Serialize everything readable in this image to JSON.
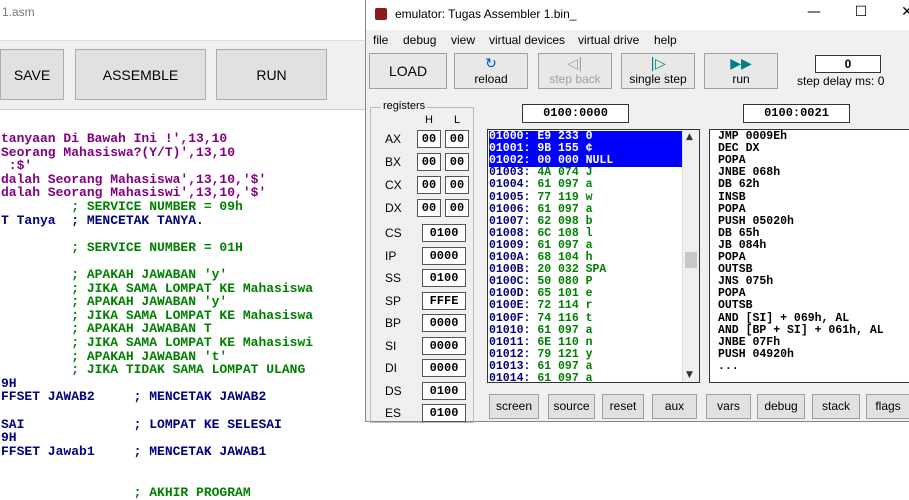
{
  "editor": {
    "title": "1.asm",
    "buttons": [
      "SAVE",
      "ASSEMBLE",
      "RUN"
    ],
    "code_lines": [
      {
        "text": "tanyaan Di Bawah Ini !',13,10",
        "color": "pur"
      },
      {
        "text": "Seorang Mahasiswa?(Y/T)',13,10",
        "color": "pur"
      },
      {
        "text": " :$'",
        "color": "pur"
      },
      {
        "text": "dalah Seorang Mahasiswa',13,10,'$'",
        "color": "pur"
      },
      {
        "text": "dalah Seorang Mahasiswi',13,10,'$'",
        "color": "pur"
      },
      {
        "text": "         ; SERVICE NUMBER = 09h",
        "color": "grn"
      },
      {
        "text": "T Tanya  ; MENCETAK TANYA.",
        "color": "blu"
      },
      {
        "text": "",
        "color": "blk"
      },
      {
        "text": "         ; SERVICE NUMBER = 01H",
        "color": "grn"
      },
      {
        "text": "",
        "color": "blk"
      },
      {
        "text": "         ; APAKAH JAWABAN 'y'",
        "color": "grn"
      },
      {
        "text": "         ; JIKA SAMA LOMPAT KE Mahasiswa",
        "color": "grn"
      },
      {
        "text": "         ; APAKAH JAWABAN 'y'",
        "color": "grn"
      },
      {
        "text": "         ; JIKA SAMA LOMPAT KE Mahasiswa",
        "color": "grn"
      },
      {
        "text": "         ; APAKAH JAWABAN T",
        "color": "grn"
      },
      {
        "text": "         ; JIKA SAMA LOMPAT KE Mahasiswi",
        "color": "grn"
      },
      {
        "text": "         ; APAKAH JAWABAN 't'",
        "color": "grn"
      },
      {
        "text": "         ; JIKA TIDAK SAMA LOMPAT ULANG",
        "color": "grn"
      },
      {
        "text": "9H",
        "color": "blu"
      },
      {
        "text": "FFSET JAWAB2     ; MENCETAK JAWAB2",
        "color": "blu"
      },
      {
        "text": "",
        "color": "blk"
      },
      {
        "text": "SAI              ; LOMPAT KE SELESAI",
        "color": "blu"
      },
      {
        "text": "9H",
        "color": "blu"
      },
      {
        "text": "FFSET Jawab1     ; MENCETAK JAWAB1",
        "color": "blu"
      },
      {
        "text": "",
        "color": "blk"
      },
      {
        "text": "",
        "color": "blk"
      },
      {
        "text": "                 ; AKHIR PROGRAM",
        "color": "grn"
      }
    ]
  },
  "emulator": {
    "title": "emulator: Tugas Assembler 1.bin_",
    "window_controls": [
      "—",
      "☐",
      "✕"
    ],
    "menu": [
      "file",
      "debug",
      "view",
      "virtual devices",
      "virtual drive",
      "help"
    ],
    "toolbar": {
      "load": "LOAD",
      "reload": "reload",
      "step_back": "step back",
      "single_step": "single step",
      "run": "run",
      "step_delay_label": "step delay ms: 0",
      "step_delay_value": "0"
    },
    "registers": {
      "legend": "registers",
      "h_label": "H",
      "l_label": "L",
      "split": [
        {
          "name": "AX",
          "h": "00",
          "l": "00"
        },
        {
          "name": "BX",
          "h": "00",
          "l": "00"
        },
        {
          "name": "CX",
          "h": "00",
          "l": "00"
        },
        {
          "name": "DX",
          "h": "00",
          "l": "00"
        }
      ],
      "full": [
        {
          "name": "CS",
          "value": "0100"
        },
        {
          "name": "IP",
          "value": "0000"
        },
        {
          "name": "SS",
          "value": "0100"
        },
        {
          "name": "SP",
          "value": "FFFE"
        },
        {
          "name": "BP",
          "value": "0000"
        },
        {
          "name": "SI",
          "value": "0000"
        },
        {
          "name": "DI",
          "value": "0000"
        },
        {
          "name": "DS",
          "value": "0100"
        },
        {
          "name": "ES",
          "value": "0100"
        }
      ]
    },
    "memory_address": "0100:0000",
    "disasm_address": "0100:0021",
    "memory_rows": [
      {
        "addr": "01000:",
        "data": " E9 233 0",
        "sel": true
      },
      {
        "addr": "01001:",
        "data": " 9B 155 ¢",
        "sel": true
      },
      {
        "addr": "01002:",
        "data": " 00 000 NULL",
        "sel": true
      },
      {
        "addr": "01003:",
        "data": " 4A 074 J",
        "sel": false
      },
      {
        "addr": "01004:",
        "data": " 61 097 a",
        "sel": false
      },
      {
        "addr": "01005:",
        "data": " 77 119 w",
        "sel": false
      },
      {
        "addr": "01006:",
        "data": " 61 097 a",
        "sel": false
      },
      {
        "addr": "01007:",
        "data": " 62 098 b",
        "sel": false
      },
      {
        "addr": "01008:",
        "data": " 6C 108 l",
        "sel": false
      },
      {
        "addr": "01009:",
        "data": " 61 097 a",
        "sel": false
      },
      {
        "addr": "0100A:",
        "data": " 68 104 h",
        "sel": false
      },
      {
        "addr": "0100B:",
        "data": " 20 032 SPA",
        "sel": false
      },
      {
        "addr": "0100C:",
        "data": " 50 080 P",
        "sel": false
      },
      {
        "addr": "0100D:",
        "data": " 65 101 e",
        "sel": false
      },
      {
        "addr": "0100E:",
        "data": " 72 114 r",
        "sel": false
      },
      {
        "addr": "0100F:",
        "data": " 74 116 t",
        "sel": false
      },
      {
        "addr": "01010:",
        "data": " 61 097 a",
        "sel": false
      },
      {
        "addr": "01011:",
        "data": " 6E 110 n",
        "sel": false
      },
      {
        "addr": "01012:",
        "data": " 79 121 y",
        "sel": false
      },
      {
        "addr": "01013:",
        "data": " 61 097 a",
        "sel": false
      },
      {
        "addr": "01014:",
        "data": " 61 097 a",
        "sel": false
      }
    ],
    "disasm_lines": [
      "JMP 0009Eh",
      "DEC DX",
      "POPA",
      "JNBE 068h",
      "DB 62h",
      "INSB",
      "POPA",
      "PUSH 05020h",
      "DB 65h",
      "JB 084h",
      "POPA",
      "OUTSB",
      "JNS 075h",
      "POPA",
      "OUTSB",
      "AND [SI] + 069h, AL",
      "AND [BP + SI] + 061h, AL",
      "JNBE 07Fh",
      "PUSH 04920h",
      "..."
    ],
    "bottom_buttons": [
      "screen",
      "source",
      "reset",
      "aux",
      "vars",
      "debug",
      "stack",
      "flags"
    ]
  }
}
